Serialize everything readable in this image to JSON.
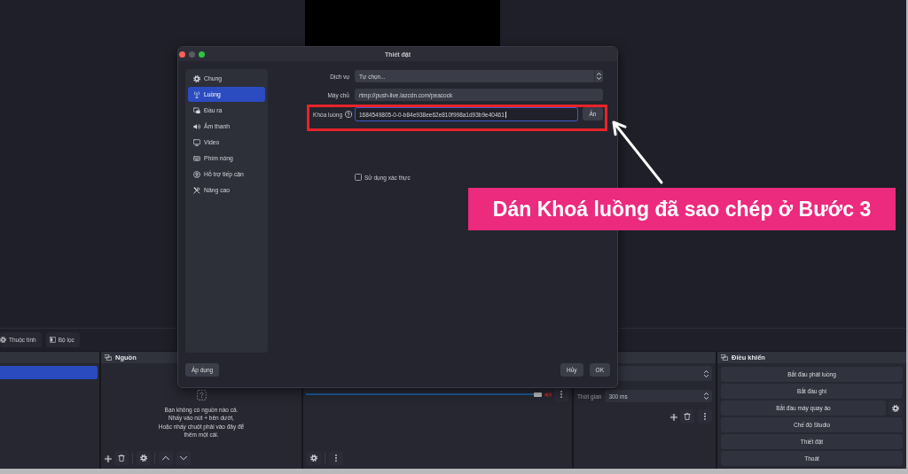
{
  "settings_dialog": {
    "title": "Thiết đặt",
    "sidebar": [
      {
        "label": "Chung",
        "selected": false
      },
      {
        "label": "Luồng",
        "selected": true
      },
      {
        "label": "Đầu ra",
        "selected": false
      },
      {
        "label": "Âm thanh",
        "selected": false
      },
      {
        "label": "Video",
        "selected": false
      },
      {
        "label": "Phím nóng",
        "selected": false
      },
      {
        "label": "Hỗ trợ tiếp cận",
        "selected": false
      },
      {
        "label": "Nâng cao",
        "selected": false
      }
    ],
    "service": {
      "label": "Dịch vụ",
      "value": "Tự chọn..."
    },
    "server": {
      "label": "Máy chủ",
      "value": "rtmp://push-live.lazcdn.com/peacock"
    },
    "stream_key": {
      "label": "Khóa luồng",
      "value": "1684549805-0-0-b84e938ee62e810f998a1d93b9e40461",
      "focused": true,
      "button": "Ẩn"
    },
    "use_auth": {
      "label": "Sử dụng xác thực",
      "checked": false
    },
    "apply_button": "Áp dụng",
    "cancel_button": "Hủy",
    "ok_button": "OK"
  },
  "toolbar": {
    "properties_button": "Thuộc tính",
    "filters_button": "Bộ lọc"
  },
  "scenes_dock": {
    "items": [
      {
        "selected": true
      }
    ]
  },
  "sources_dock": {
    "title": "Nguồn",
    "empty_message": "Bạn không có nguồn nào cả.\nNhấy vào nút + bên dưới,\nHoặc nhấy chuột phải vào đây để\nthêm một cái."
  },
  "audio_mixer": {
    "channels": [
      {
        "level": 1,
        "muted": true
      }
    ]
  },
  "transitions_dock": {
    "duration_label": "Thời gian",
    "duration": "300 ms"
  },
  "controls_dock": {
    "title": "Điều khiển",
    "buttons": [
      {
        "label": "Bắt đầu phát luồng",
        "kind": "plain"
      },
      {
        "label": "Bắt đầu ghi",
        "kind": "plain"
      },
      {
        "label": "Bắt đầu máy quay ảo",
        "kind": "with_settings"
      },
      {
        "label": "Chế độ Studio",
        "kind": "plain"
      },
      {
        "label": "Thiết đặt",
        "kind": "plain"
      },
      {
        "label": "Thoát",
        "kind": "plain"
      }
    ]
  },
  "callout": {
    "text": "Dán Khoá luồng đã sao chép ở Bước 3"
  }
}
